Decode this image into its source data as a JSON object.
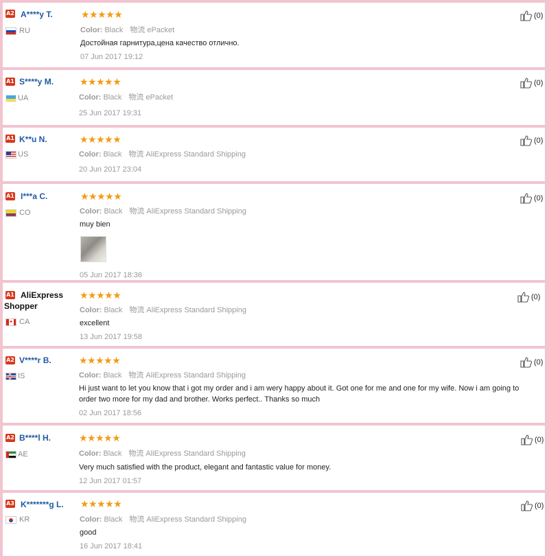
{
  "reviews": [
    {
      "badge": "A2",
      "name": "A****y T.",
      "country": "RU",
      "flag": "ru",
      "stars": "★★★★★",
      "color_label": "Color:",
      "color_value": "Black",
      "shipping_label": "物流",
      "shipping_value": "ePacket",
      "text": "Достойная гарнитура,цена качество отлично.",
      "date": "07 Jun 2017 19:12",
      "helpful": "(0)",
      "has_photo": false
    },
    {
      "badge": "A1",
      "name": "S****y M.",
      "country": "UA",
      "flag": "ua",
      "stars": "★★★★★",
      "color_label": "Color:",
      "color_value": "Black",
      "shipping_label": "物流",
      "shipping_value": "ePacket",
      "text": "",
      "date": "25 Jun 2017 19:31",
      "helpful": "(0)",
      "has_photo": false
    },
    {
      "badge": "A1",
      "name": "K**u N.",
      "country": "US",
      "flag": "us",
      "stars": "★★★★★",
      "color_label": "Color:",
      "color_value": "Black",
      "shipping_label": "物流",
      "shipping_value": "AliExpress Standard Shipping",
      "text": "",
      "date": "20 Jun 2017 23:04",
      "helpful": "(0)",
      "has_photo": false
    },
    {
      "badge": "A1",
      "name": "I***a C.",
      "country": "CO",
      "flag": "co",
      "stars": "★★★★★",
      "color_label": "Color:",
      "color_value": "Black",
      "shipping_label": "物流",
      "shipping_value": "AliExpress Standard Shipping",
      "text": "muy bien",
      "date": "05 Jun 2017 18:36",
      "helpful": "(0)",
      "has_photo": true
    },
    {
      "badge": "A1",
      "name": "AliExpress Shopper",
      "country": "CA",
      "flag": "ca",
      "stars": "★★★★★",
      "color_label": "Color:",
      "color_value": "Black",
      "shipping_label": "物流",
      "shipping_value": "AliExpress Standard Shipping",
      "text": "excellent",
      "date": "13 Jun 2017 19:58",
      "helpful": "(0)",
      "has_photo": false
    },
    {
      "badge": "A2",
      "name": "V****r B.",
      "country": "IS",
      "flag": "is",
      "stars": "★★★★★",
      "color_label": "Color:",
      "color_value": "Black",
      "shipping_label": "物流",
      "shipping_value": "AliExpress Standard Shipping",
      "text": "Hi just want to let you know that i got my order and i am wery happy about it. Got one for me and one for my wife. Now i am going to order two more for my dad and brother. Works perfect.. Thanks so much",
      "date": "02 Jun 2017 18:56",
      "helpful": "(0)",
      "has_photo": false
    },
    {
      "badge": "A2",
      "name": "B****l H.",
      "country": "AE",
      "flag": "ae",
      "stars": "★★★★★",
      "color_label": "Color:",
      "color_value": "Black",
      "shipping_label": "物流",
      "shipping_value": "AliExpress Standard Shipping",
      "text": "Very much satisfied with the product, elegant and fantastic value for money.",
      "date": "12 Jun 2017 01:57",
      "helpful": "(0)",
      "has_photo": false
    },
    {
      "badge": "A3",
      "name": "K*******g L.",
      "country": "KR",
      "flag": "kr",
      "stars": "★★★★★",
      "color_label": "Color:",
      "color_value": "Black",
      "shipping_label": "物流",
      "shipping_value": "AliExpress Standard Shipping",
      "text": "good",
      "date": "16 Jun 2017 18:41",
      "helpful": "(0)",
      "has_photo": false
    }
  ]
}
